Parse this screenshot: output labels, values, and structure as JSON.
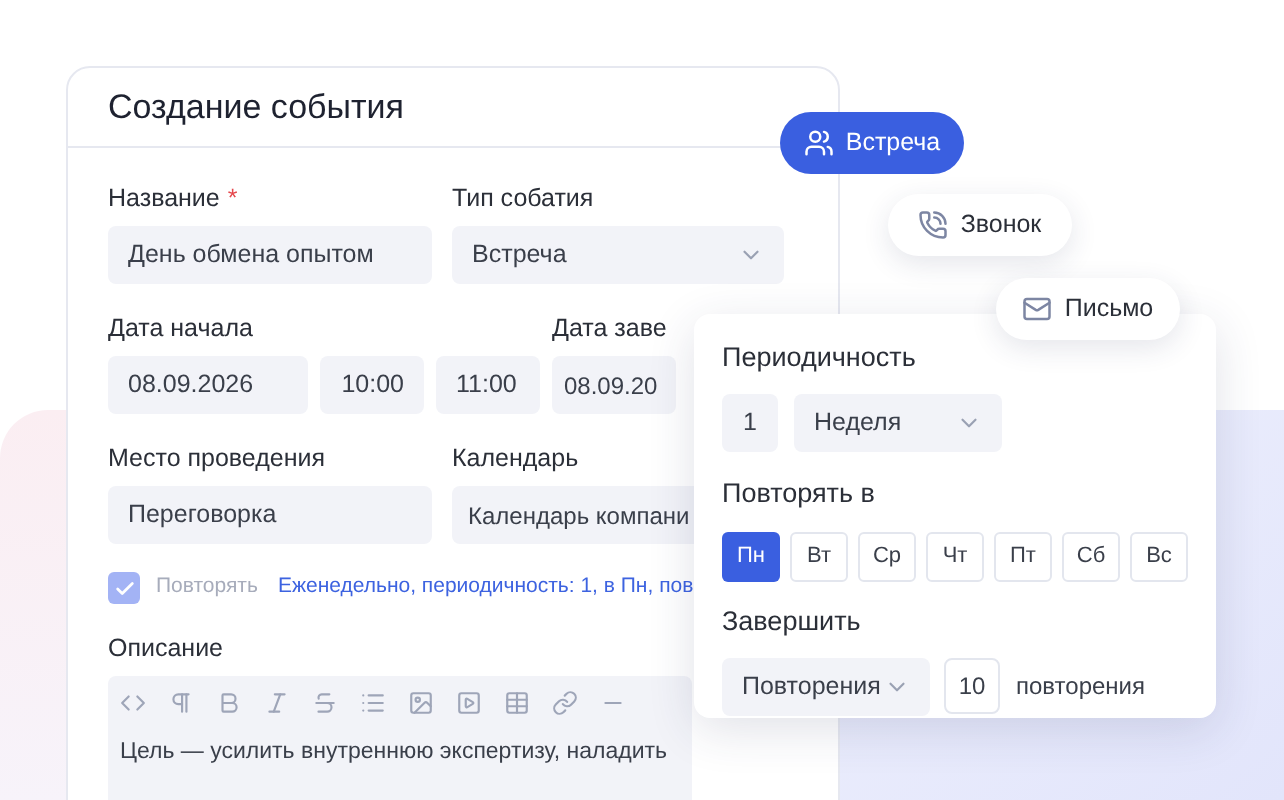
{
  "form": {
    "title": "Создание события",
    "name_label": "Название",
    "required_mark": "*",
    "name_value": "День обмена опытом",
    "type_label": "Тип собатия",
    "type_value": "Встреча",
    "start_label": "Дата начала",
    "start_date": "08.09.2026",
    "start_time": "10:00",
    "end_time": "11:00",
    "end_label": "Дата заве",
    "end_date": "08.09.20",
    "place_label": "Место проведения",
    "place_value": "Переговорка",
    "calendar_label": "Календарь",
    "calendar_value": "Календарь компани",
    "repeat": {
      "label": "Повторять",
      "checked": true,
      "summary": "Еженедельно, периодичность: 1, в Пн, пов"
    },
    "description_label": "Описание",
    "description_text": "Цель — усилить внутреннюю экспертизу, наладить"
  },
  "event_types": [
    {
      "kind": "meeting",
      "label": "Встреча",
      "selected": true
    },
    {
      "kind": "call",
      "label": "Звонок",
      "selected": false
    },
    {
      "kind": "letter",
      "label": "Письмо",
      "selected": false
    }
  ],
  "recurrence": {
    "period_title": "Периодичность",
    "period_count": "1",
    "period_unit": "Неделя",
    "days_title": "Повторять в",
    "days": [
      {
        "label": "Пн",
        "selected": true
      },
      {
        "label": "Вт",
        "selected": false
      },
      {
        "label": "Ср",
        "selected": false
      },
      {
        "label": "Чт",
        "selected": false
      },
      {
        "label": "Пт",
        "selected": false
      },
      {
        "label": "Сб",
        "selected": false
      },
      {
        "label": "Вс",
        "selected": false
      }
    ],
    "end_title": "Завершить",
    "end_mode": "Повторения",
    "end_count": "10",
    "end_suffix": "повторения"
  }
}
